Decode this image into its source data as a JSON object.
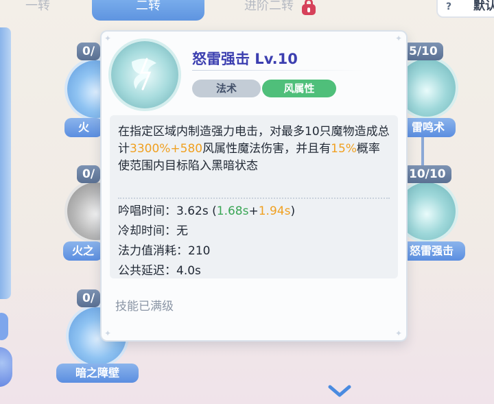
{
  "tabs": [
    {
      "label": "一转"
    },
    {
      "label": "二转"
    },
    {
      "label": "进阶二转"
    }
  ],
  "default_button": {
    "label": "默认",
    "help": "?"
  },
  "skill_nodes": [
    {
      "level": "0/",
      "name": "火"
    },
    {
      "level": "0/",
      "name": "火之"
    },
    {
      "level": "0/",
      "name": "暗之障壁"
    },
    {
      "level": "5/10",
      "name": "雷鸣术"
    },
    {
      "level": "10/10",
      "name": "怒雷强击"
    }
  ],
  "tooltip": {
    "title": "怒雷强击 Lv.10",
    "tags": {
      "school": "法术",
      "element": "风属性"
    },
    "description": {
      "p1": "在指定区域内制造强力电击，对最多10只魔物造成总计",
      "dmg_pct": "3300%",
      "plus": "+",
      "dmg_flat": "580",
      "p2": "风属性魔法伤害，并且有",
      "chance": "15%",
      "p3": "概率使范围内目标陷入黑暗状态"
    },
    "stats": {
      "cast_label": "吟唱时间：",
      "cast_value": "3.62s",
      "cast_open": " (",
      "cast_green": "1.68s",
      "cast_plus": "+",
      "cast_orange": "1.94s",
      "cast_close": ")",
      "cooldown": "冷却时间：无",
      "mana": "法力值消耗：210",
      "delay": "公共延迟：4.0s"
    },
    "status": "技能已满级"
  },
  "colors": {
    "title": "#3c3fb0",
    "orange": "#f0a020",
    "green": "#3aa655",
    "element_tag": "#4fbf7a",
    "tab_active": "#5e94e0"
  }
}
